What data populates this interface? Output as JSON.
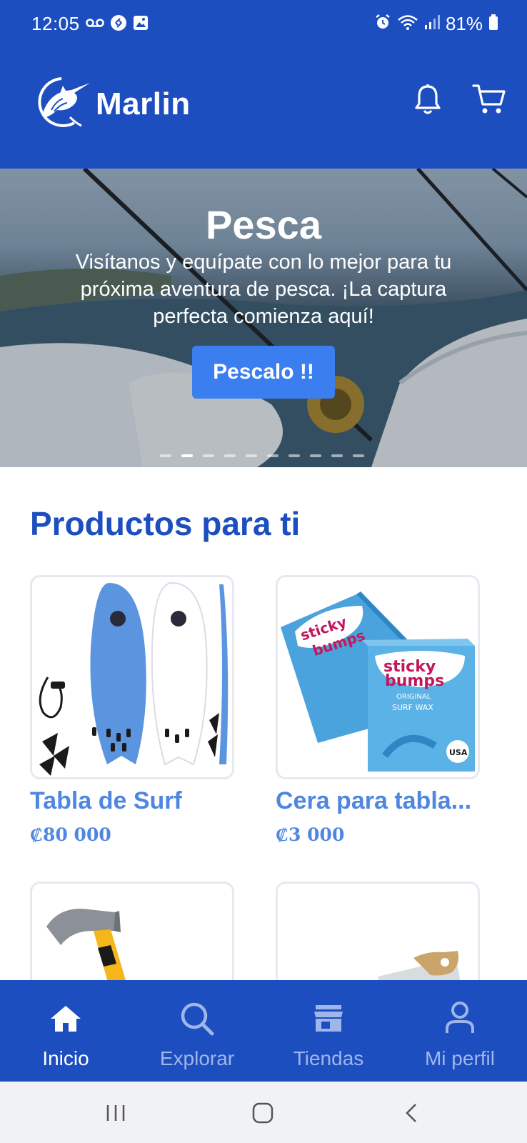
{
  "status_bar": {
    "time": "12:05",
    "battery": "81%",
    "left_icons": [
      "voicemail-icon",
      "shazam-icon",
      "gallery-icon"
    ],
    "right_icons": [
      "alarm-icon",
      "wifi-icon",
      "signal-icon",
      "battery-icon"
    ]
  },
  "header": {
    "brand": "Marlin",
    "logo_icon": "marlin-fish-logo",
    "actions": [
      "bell-icon",
      "cart-icon"
    ]
  },
  "hero": {
    "title": "Pesca",
    "text": "Visítanos y equípate con lo mejor para tu próxima aventura de pesca. ¡La captura perfecta comienza aquí!",
    "button_label": "Pescalo !!",
    "slide_count": 10,
    "active_slide": 2
  },
  "section": {
    "title": "Productos para ti"
  },
  "products": [
    {
      "name": "Tabla de Surf",
      "price": "₡80 000"
    },
    {
      "name": "Cera para tabla...",
      "price": "₡3 000"
    },
    {
      "name": "",
      "price": ""
    },
    {
      "name": "",
      "price": ""
    }
  ],
  "bottom_nav": {
    "items": [
      {
        "label": "Inicio",
        "icon": "home-icon",
        "active": true
      },
      {
        "label": "Explorar",
        "icon": "search-icon",
        "active": false
      },
      {
        "label": "Tiendas",
        "icon": "store-icon",
        "active": false
      },
      {
        "label": "Mi perfil",
        "icon": "user-icon",
        "active": false
      }
    ]
  },
  "system_nav": [
    "recents-button",
    "home-button",
    "back-button"
  ],
  "colors": {
    "primary": "#1c4ec0",
    "accent": "#3a7ef0",
    "product_text": "#4e86e0"
  }
}
